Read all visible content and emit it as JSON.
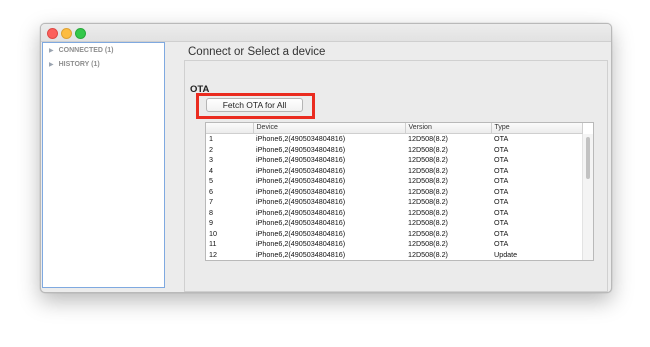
{
  "window": {
    "controls": [
      "close",
      "minimize",
      "zoom"
    ]
  },
  "sidebar": {
    "items": [
      {
        "label": "CONNECTED (1)",
        "icon": "disclosure-triangle-icon"
      },
      {
        "label": "HISTORY (1)",
        "icon": "disclosure-triangle-icon"
      }
    ]
  },
  "main": {
    "title": "Connect or Select a device",
    "section_label": "OTA",
    "fetch_button_label": "Fetch OTA for All",
    "highlight_color": "#ea2b1f"
  },
  "table": {
    "columns": [
      "",
      "Device",
      "Version",
      "Type"
    ],
    "rows": [
      [
        "1",
        "iPhone6,2(4905034804816)",
        "12D508(8.2)",
        "OTA"
      ],
      [
        "2",
        "iPhone6,2(4905034804816)",
        "12D508(8.2)",
        "OTA"
      ],
      [
        "3",
        "iPhone6,2(4905034804816)",
        "12D508(8.2)",
        "OTA"
      ],
      [
        "4",
        "iPhone6,2(4905034804816)",
        "12D508(8.2)",
        "OTA"
      ],
      [
        "5",
        "iPhone6,2(4905034804816)",
        "12D508(8.2)",
        "OTA"
      ],
      [
        "6",
        "iPhone6,2(4905034804816)",
        "12D508(8.2)",
        "OTA"
      ],
      [
        "7",
        "iPhone6,2(4905034804816)",
        "12D508(8.2)",
        "OTA"
      ],
      [
        "8",
        "iPhone6,2(4905034804816)",
        "12D508(8.2)",
        "OTA"
      ],
      [
        "9",
        "iPhone6,2(4905034804816)",
        "12D508(8.2)",
        "OTA"
      ],
      [
        "10",
        "iPhone6,2(4905034804816)",
        "12D508(8.2)",
        "OTA"
      ],
      [
        "11",
        "iPhone6,2(4905034804816)",
        "12D508(8.2)",
        "OTA"
      ],
      [
        "12",
        "iPhone6,2(4905034804816)",
        "12D508(8.2)",
        "Update"
      ]
    ]
  }
}
